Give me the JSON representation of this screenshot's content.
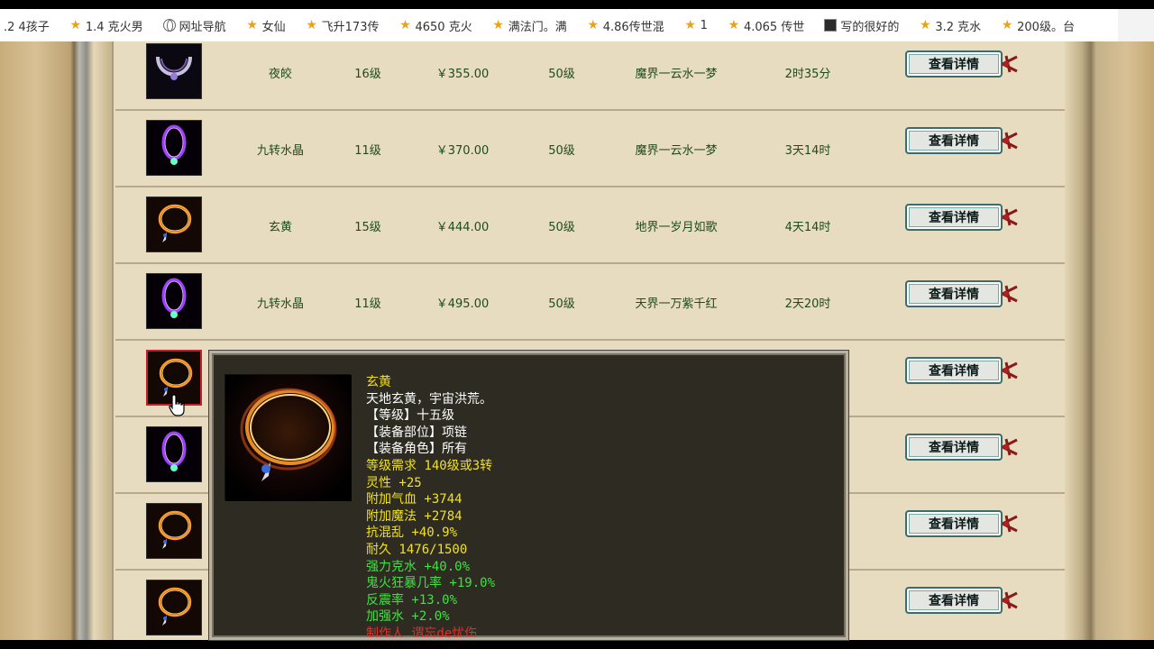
{
  "bookmarks": [
    {
      "label": ".2 4孩子",
      "icon": "none"
    },
    {
      "label": "1.4 克火男",
      "icon": "star"
    },
    {
      "label": "网址导航",
      "icon": "globe"
    },
    {
      "label": "女仙",
      "icon": "star"
    },
    {
      "label": "飞升173传",
      "icon": "star"
    },
    {
      "label": "4650 克火",
      "icon": "star"
    },
    {
      "label": "满法门。满",
      "icon": "star"
    },
    {
      "label": "4.86传世混",
      "icon": "star"
    },
    {
      "label": "1",
      "icon": "star"
    },
    {
      "label": "4.065 传世",
      "icon": "star"
    },
    {
      "label": "写的很好的",
      "icon": "thumb"
    },
    {
      "label": "3.2   克水",
      "icon": "star"
    },
    {
      "label": "200级。台",
      "icon": "star"
    }
  ],
  "colors": {
    "cell_text": "#1f4a1f",
    "button_border": "#3a6d6b",
    "tooltip_bg": "#2d2b22"
  },
  "listing": {
    "button_label": "查看详情",
    "rows": [
      {
        "item": "夜皎",
        "level": "16级",
        "price": "￥355.00",
        "req": "50级",
        "seller": "魔界一云水一梦",
        "time": "2时35分",
        "icon": "night-necklace-icon"
      },
      {
        "item": "九转水晶",
        "level": "11级",
        "price": "￥370.00",
        "req": "50级",
        "seller": "魔界一云水一梦",
        "time": "3天14时",
        "icon": "purple-crystal-necklace-icon"
      },
      {
        "item": "玄黄",
        "level": "15级",
        "price": "￥444.00",
        "req": "50级",
        "seller": "地界一岁月如歌",
        "time": "4天14时",
        "icon": "gold-necklace-icon"
      },
      {
        "item": "九转水晶",
        "level": "11级",
        "price": "￥495.00",
        "req": "50级",
        "seller": "天界一万紫千红",
        "time": "2天20时",
        "icon": "purple-crystal-necklace-icon"
      },
      {
        "item": "",
        "level": "",
        "price": "",
        "req": "",
        "seller": "",
        "time": "",
        "icon": "gold-necklace-icon",
        "active": true
      },
      {
        "item": "",
        "level": "",
        "price": "",
        "req": "",
        "seller": "",
        "time": "",
        "icon": "purple-crystal-necklace-icon"
      },
      {
        "item": "",
        "level": "",
        "price": "",
        "req": "",
        "seller": "",
        "time": "",
        "icon": "gold-necklace-icon"
      },
      {
        "item": "",
        "level": "",
        "price": "",
        "req": "",
        "seller": "",
        "time": "",
        "icon": "gold-necklace-icon"
      }
    ]
  },
  "tooltip": {
    "lines": [
      {
        "text": "玄黄",
        "color": "#f2e21c"
      },
      {
        "text": "天地玄黄，宇宙洪荒。",
        "color": "#ffffff"
      },
      {
        "text": "【等级】十五级",
        "color": "#ffffff"
      },
      {
        "text": "【装备部位】项链",
        "color": "#ffffff"
      },
      {
        "text": "【装备角色】所有",
        "color": "#ffffff"
      },
      {
        "text": "等级需求 140级或3转",
        "color": "#f2e21c"
      },
      {
        "text": "灵性 +25",
        "color": "#f2e21c"
      },
      {
        "text": "附加气血 +3744",
        "color": "#f2e21c"
      },
      {
        "text": "附加魔法 +2784",
        "color": "#f2e21c"
      },
      {
        "text": "抗混乱 +40.9%",
        "color": "#f2e21c"
      },
      {
        "text": "耐久 1476/1500",
        "color": "#f2e21c"
      },
      {
        "text": "强力克水 +40.0%",
        "color": "#3fe23f"
      },
      {
        "text": "鬼火狂暴几率 +19.0%",
        "color": "#3fe23f"
      },
      {
        "text": "反震率 +13.0%",
        "color": "#3fe23f"
      },
      {
        "text": "加强水 +2.0%",
        "color": "#3fe23f"
      },
      {
        "text": "制作人 谓忘de忧伤",
        "color": "#e0302a"
      }
    ]
  }
}
